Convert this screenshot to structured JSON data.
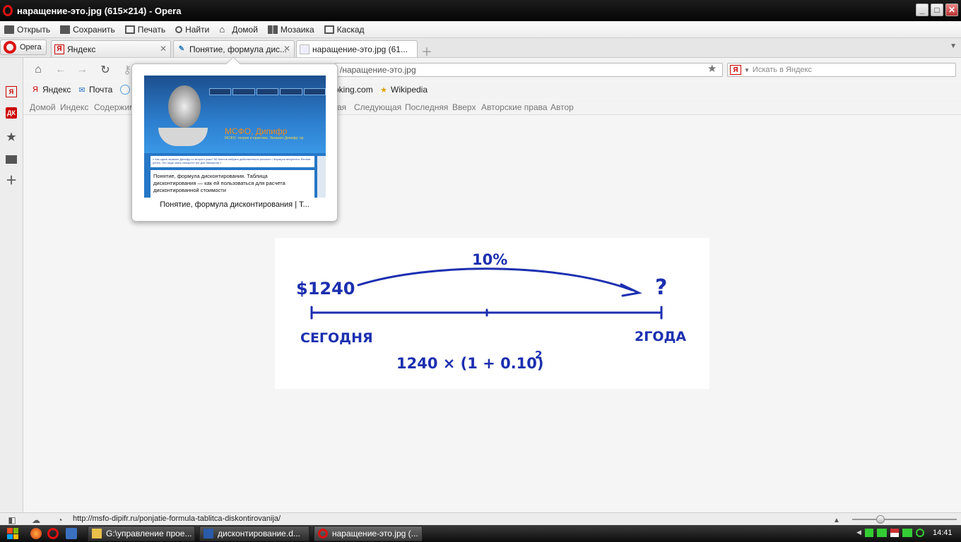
{
  "window": {
    "title": "наращение-это.jpg (615×214) - Opera"
  },
  "menubar": {
    "items": [
      {
        "label": "Открыть",
        "icon": "folder-icon"
      },
      {
        "label": "Сохранить",
        "icon": "save-icon"
      },
      {
        "label": "Печать",
        "icon": "print-icon"
      },
      {
        "label": "Найти",
        "icon": "search-icon"
      },
      {
        "label": "Домой",
        "icon": "home-icon"
      },
      {
        "label": "Мозаика",
        "icon": "tile-icon"
      },
      {
        "label": "Каскад",
        "icon": "cascade-icon"
      }
    ]
  },
  "tabs": {
    "opera_menu": "Opera",
    "items": [
      {
        "label": "Яндекс",
        "favicon": "Я"
      },
      {
        "label": "Понятие, формула дис...",
        "favicon": "✎"
      },
      {
        "label": "наращение-это.jpg (61...",
        "favicon": ""
      }
    ]
  },
  "navbar": {
    "address": "/наращение-это.jpg",
    "search_placeholder": "Искать в Яндекс",
    "search_engine": "Я"
  },
  "bookmarks": {
    "items": [
      {
        "label": "Яндекс",
        "icon": "Я"
      },
      {
        "label": "Почта",
        "icon": "✉"
      },
      {
        "label": "oking.com",
        "icon": ""
      },
      {
        "label": "Wikipedia",
        "icon": "★"
      }
    ]
  },
  "navlinks": {
    "left": [
      "Домой",
      "Индекс",
      "Содержим"
    ],
    "right": [
      "ая",
      "Следующая",
      "Последняя",
      "Вверх",
      "Авторские права",
      "Автор"
    ]
  },
  "preview": {
    "caption": "Понятие, формула дисконтирования | Т...",
    "site_title": "МСФО, Дипифр",
    "site_subtitle": "МСФО: теория и практика. Экзамен Дипифр: пр",
    "breadcrumb": "« Как сдать экзамен Дипифр со второго раза? 60 баллов набрать действительно реально • Формула аннуитета. Вечная рента. Это надо знать наизусть! (не для банкиров) »",
    "article_title": "Понятие, формула дисконтирования. Таблица дисконтирования — как ей пользоваться для расчета дисконтированной стоимости"
  },
  "image": {
    "rate": "10%",
    "amount": "$1240",
    "question": "?",
    "today": "СЕГОДНЯ",
    "period": "2ГОДА",
    "formula": "1240 × (1 + 0.10)",
    "exponent": "2",
    "ink_color": "#1c2fb0"
  },
  "status": {
    "url": "http://msfo-dipifr.ru/ponjatie-formula-tablitca-diskontirovanija/"
  },
  "taskbar": {
    "tasks": [
      {
        "label": "G:\\управление прое..."
      },
      {
        "label": "дисконтирование.d..."
      },
      {
        "label": "наращение-это.jpg (..."
      }
    ],
    "clock": "14:41"
  }
}
